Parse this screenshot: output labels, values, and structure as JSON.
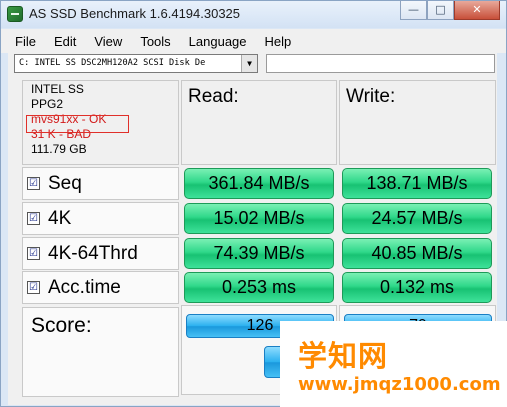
{
  "window": {
    "title": "AS SSD Benchmark 1.6.4194.30325",
    "controls": {
      "minimize": "—",
      "maximize": "□",
      "close": "✕"
    }
  },
  "menu": [
    "File",
    "Edit",
    "View",
    "Tools",
    "Language",
    "Help"
  ],
  "drive": {
    "selected": "C: INTEL SS DSC2MH120A2 SCSI Disk De",
    "dropdown_icon": "▼"
  },
  "info": {
    "model": "INTEL SS",
    "firmware": "PPG2",
    "driver": "mvs91xx - OK",
    "alignment": "31 K - BAD",
    "size": "111.79 GB"
  },
  "headers": {
    "read": "Read:",
    "write": "Write:"
  },
  "tests": [
    {
      "label": "Seq",
      "checked": true,
      "read": "361.84 MB/s",
      "write": "138.71 MB/s"
    },
    {
      "label": "4K",
      "checked": true,
      "read": "15.02 MB/s",
      "write": "24.57 MB/s"
    },
    {
      "label": "4K-64Thrd",
      "checked": true,
      "read": "74.39 MB/s",
      "write": "40.85 MB/s"
    },
    {
      "label": "Acc.time",
      "checked": true,
      "read": "0.253 ms",
      "write": "0.132 ms"
    }
  ],
  "score": {
    "label": "Score:",
    "read": "126",
    "write": "79"
  },
  "checkbox_glyph": "☑",
  "watermark": {
    "main": "学知网",
    "url": "www.jmqz1000.com"
  },
  "colors": {
    "result_green": "#2fd88a",
    "score_blue": "#2ab0ef",
    "warning_red": "#d21a1a",
    "watermark_orange": "#ff8a00"
  }
}
